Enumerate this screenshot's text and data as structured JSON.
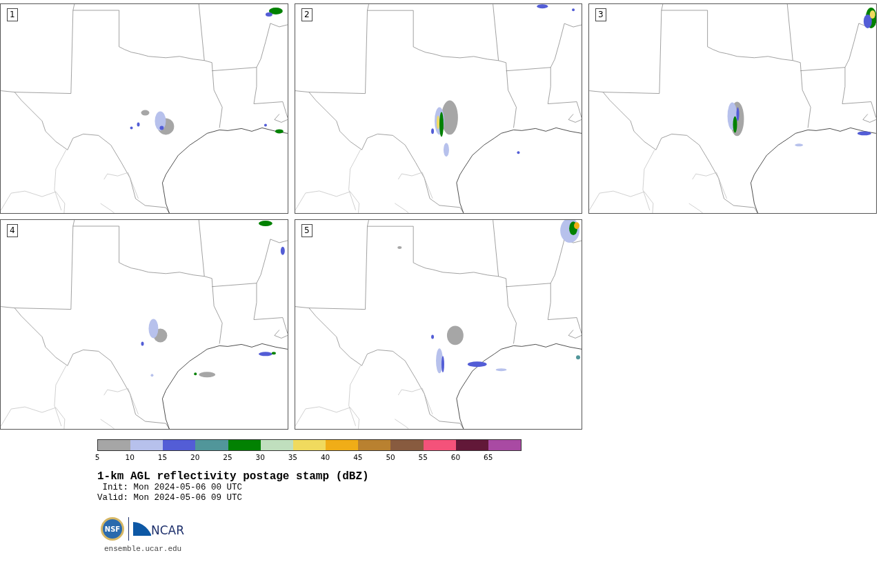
{
  "panels": [
    {
      "label": "1"
    },
    {
      "label": "2"
    },
    {
      "label": "3"
    },
    {
      "label": "4"
    },
    {
      "label": "5"
    }
  ],
  "colorbar": {
    "segments": [
      {
        "color": "#a6a6a6"
      },
      {
        "color": "#b7c1ec"
      },
      {
        "color": "#535dd6"
      },
      {
        "color": "#51969a"
      },
      {
        "color": "#028102"
      },
      {
        "color": "#c0dfbe"
      },
      {
        "color": "#f0da5e"
      },
      {
        "color": "#f0ad17"
      },
      {
        "color": "#b98130"
      },
      {
        "color": "#885b3f"
      },
      {
        "color": "#f4527a"
      },
      {
        "color": "#621838"
      },
      {
        "color": "#a94aa3"
      }
    ],
    "ticks": [
      "5",
      "10",
      "15",
      "20",
      "25",
      "30",
      "35",
      "40",
      "45",
      "50",
      "55",
      "60",
      "65"
    ]
  },
  "title": "1-km AGL reflectivity postage stamp (dBZ)",
  "init": " Init: Mon 2024-05-06 00 UTC",
  "valid": "Valid: Mon 2024-05-06 09 UTC",
  "logo": {
    "left": "NSF",
    "right": "NCAR"
  },
  "url": "ensemble.ucar.edu"
}
